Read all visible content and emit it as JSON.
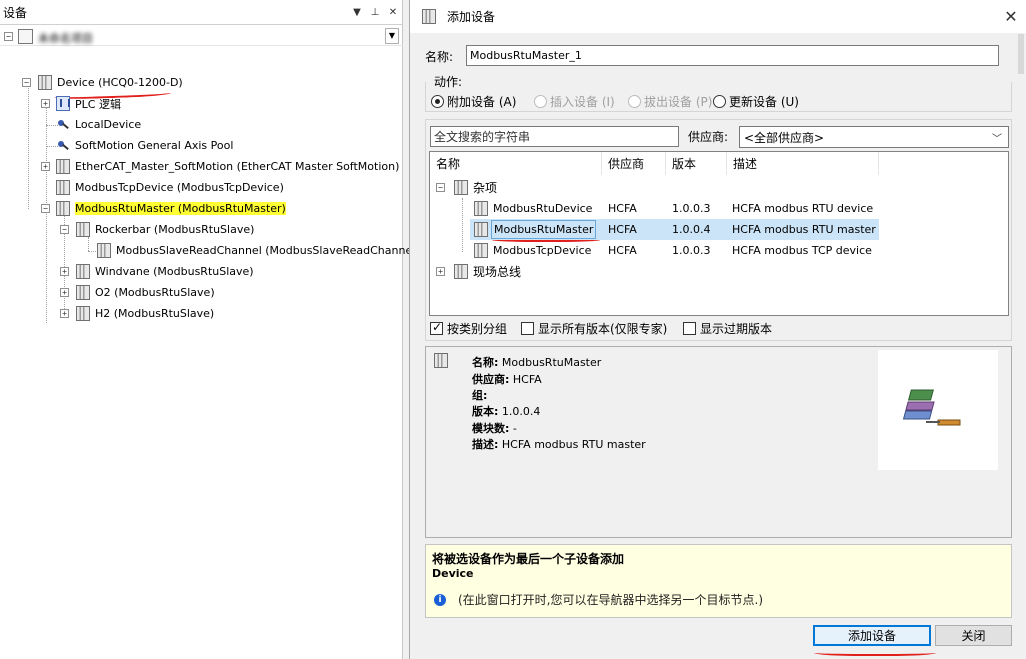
{
  "left_panel": {
    "title": "设备",
    "controls": {
      "dropdown": "▼",
      "pin": "⊥",
      "close": "✕"
    },
    "root_label": "未命名项目",
    "tree": [
      {
        "label": "Device (HCQ0-1200-D)",
        "icon": "device-icon"
      },
      {
        "label": "PLC 逻辑",
        "icon": "plc-logic-icon"
      },
      {
        "label": "LocalDevice",
        "icon": "local-device-icon"
      },
      {
        "label": "SoftMotion General Axis Pool",
        "icon": "axis-pool-icon"
      },
      {
        "label": "EtherCAT_Master_SoftMotion (EtherCAT Master SoftMotion)",
        "icon": "device-icon"
      },
      {
        "label": "ModbusTcpDevice (ModbusTcpDevice)",
        "icon": "device-icon"
      },
      {
        "label": "ModbusRtuMaster (ModbusRtuMaster)",
        "icon": "device-icon",
        "highlight": "#ffff33"
      },
      {
        "label": "Rockerbar (ModbusRtuSlave)",
        "icon": "device-icon"
      },
      {
        "label": "ModbusSlaveReadChannel (ModbusSlaveReadChannel)",
        "icon": "device-icon"
      },
      {
        "label": "Windvane (ModbusRtuSlave)",
        "icon": "device-icon"
      },
      {
        "label": "O2 (ModbusRtuSlave)",
        "icon": "device-icon"
      },
      {
        "label": "H2 (ModbusRtuSlave)",
        "icon": "device-icon"
      }
    ]
  },
  "dialog": {
    "title": "添加设备",
    "close_glyph": "✕",
    "name_label": "名称:",
    "name_value": "ModbusRtuMaster_1",
    "action_label": "动作:",
    "actions": [
      {
        "label": "附加设备 (A)",
        "checked": true,
        "enabled": true
      },
      {
        "label": "插入设备 (I)",
        "checked": false,
        "enabled": false
      },
      {
        "label": "拔出设备 (P)",
        "checked": false,
        "enabled": false
      },
      {
        "label": "更新设备 (U)",
        "checked": false,
        "enabled": true
      }
    ],
    "search_placeholder": "全文搜索的字符串",
    "vendor_label": "供应商:",
    "vendor_value": "<全部供应商>",
    "columns": [
      "名称",
      "供应商",
      "版本",
      "描述"
    ],
    "groups": {
      "misc": "杂项",
      "fieldbus": "现场总线"
    },
    "rows": [
      {
        "name": "ModbusRtuDevice",
        "vendor": "HCFA",
        "version": "1.0.0.3",
        "desc": "HCFA modbus RTU device",
        "selected": false
      },
      {
        "name": "ModbusRtuMaster",
        "vendor": "HCFA",
        "version": "1.0.0.4",
        "desc": "HCFA modbus RTU master",
        "selected": true
      },
      {
        "name": "ModbusTcpDevice",
        "vendor": "HCFA",
        "version": "1.0.0.3",
        "desc": "HCFA modbus TCP device",
        "selected": false
      }
    ],
    "options": [
      {
        "label": "按类别分组",
        "checked": true
      },
      {
        "label": "显示所有版本(仅限专家)",
        "checked": false
      },
      {
        "label": "显示过期版本",
        "checked": false
      }
    ],
    "info": {
      "name_key": "名称:",
      "name_val": "ModbusRtuMaster",
      "vendor_key": "供应商:",
      "vendor_val": "HCFA",
      "group_key": "组:",
      "group_val": "",
      "version_key": "版本:",
      "version_val": "1.0.0.4",
      "modnum_key": "模块数:",
      "modnum_val": "-",
      "desc_key": "描述:",
      "desc_val": "HCFA modbus RTU master"
    },
    "notice_title": "将被选设备作为最后一个子设备添加",
    "notice_target": "Device",
    "notice_hint": "(在此窗口打开时,您可以在导航器中选择另一个目标节点.)",
    "add_button": "添加设备",
    "close_button": "关闭",
    "accent": "#0078d7",
    "annotation_color": "#e0201c"
  }
}
